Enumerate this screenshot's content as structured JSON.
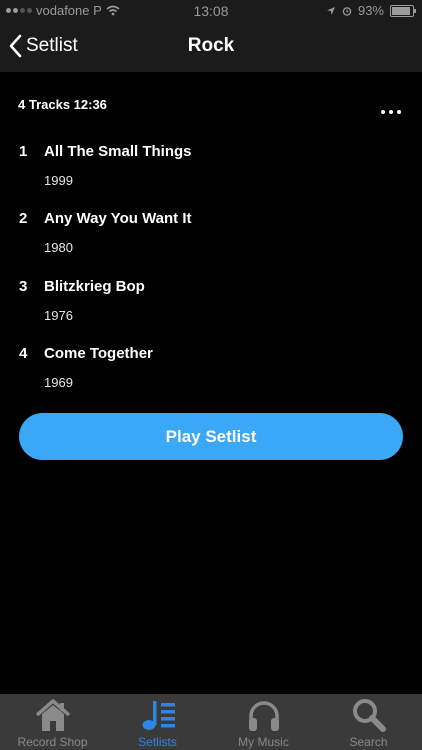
{
  "status": {
    "carrier": "vodafone P",
    "time": "13:08",
    "battery": "93%"
  },
  "nav": {
    "back_label": "Setlist",
    "title": "Rock"
  },
  "summary": "4 Tracks 12:36",
  "tracks": [
    {
      "num": "1",
      "title": "All The Small Things",
      "year": "1999"
    },
    {
      "num": "2",
      "title": "Any Way You Want It",
      "year": "1980"
    },
    {
      "num": "3",
      "title": "Blitzkrieg Bop",
      "year": "1976"
    },
    {
      "num": "4",
      "title": "Come Together",
      "year": "1969"
    }
  ],
  "play_button": "Play Setlist",
  "tabs": [
    {
      "label": "Record Shop",
      "icon": "house-icon"
    },
    {
      "label": "Setlists",
      "icon": "music-list-icon",
      "active": true
    },
    {
      "label": "My Music",
      "icon": "headphones-icon"
    },
    {
      "label": "Search",
      "icon": "search-icon"
    }
  ],
  "colors": {
    "accent": "#3aa8f6",
    "tab_active": "#2f86e6",
    "bar_bg": "#1b1b1b",
    "tabbar_bg": "#3a3a3a"
  }
}
